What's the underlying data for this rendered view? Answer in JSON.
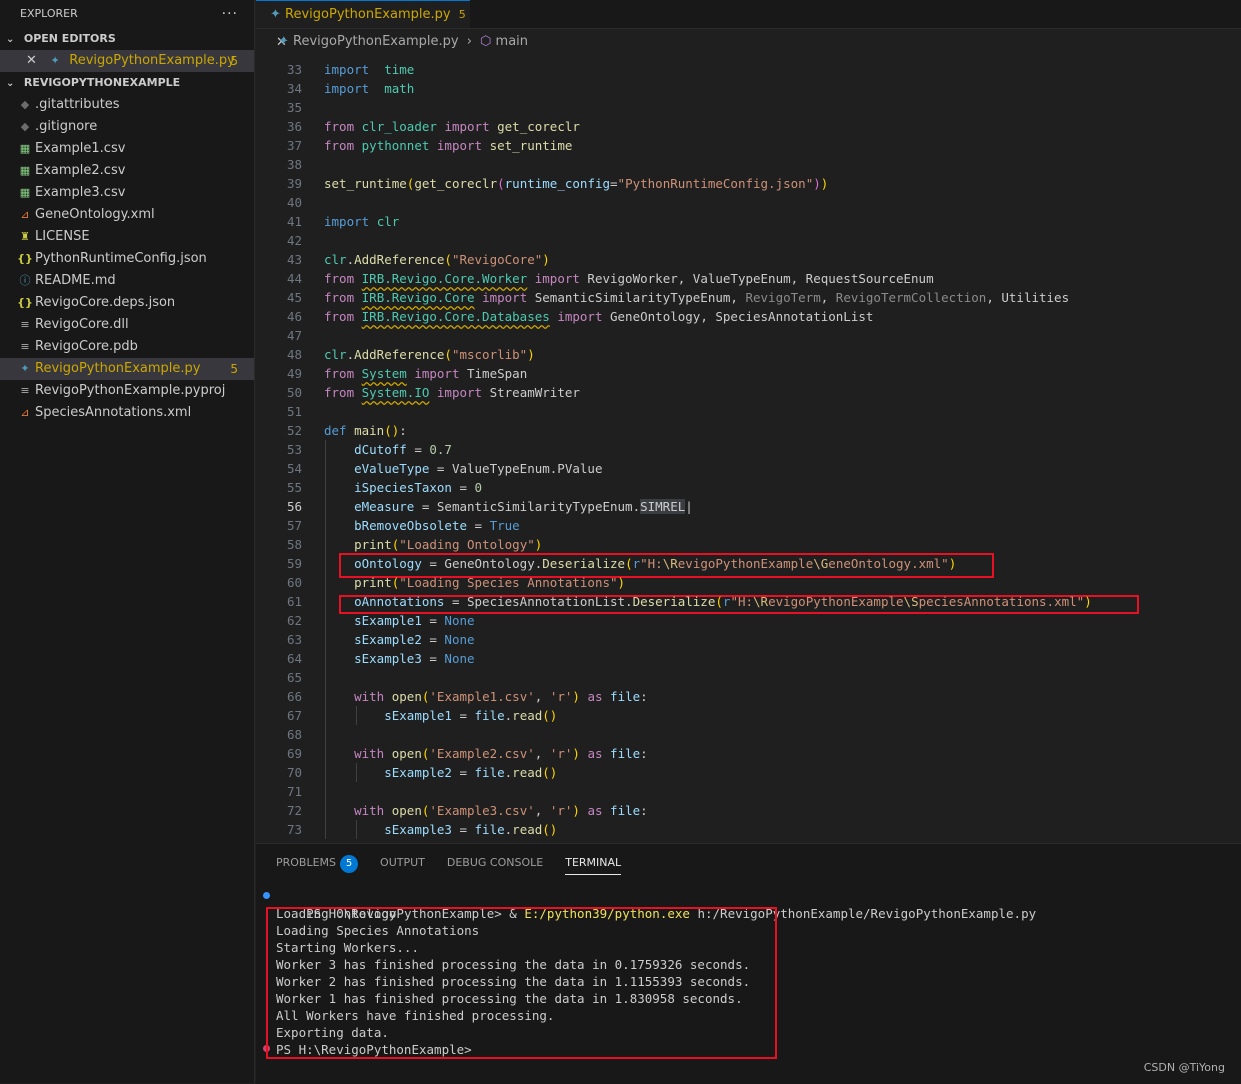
{
  "explorer": {
    "title": "EXPLORER",
    "more": "···",
    "open_editors_label": "OPEN EDITORS",
    "open_editor": {
      "name": "RevigoPythonExample.py",
      "badge": "5",
      "close": "✕"
    },
    "project_label": "REVIGOPYTHONEXAMPLE",
    "files": [
      {
        "name": ".gitattributes",
        "icon": "git-icon",
        "glyph": "◆"
      },
      {
        "name": ".gitignore",
        "icon": "git-icon",
        "glyph": "◆"
      },
      {
        "name": "Example1.csv",
        "icon": "csv-icon",
        "glyph": "▦"
      },
      {
        "name": "Example2.csv",
        "icon": "csv-icon",
        "glyph": "▦"
      },
      {
        "name": "Example3.csv",
        "icon": "csv-icon",
        "glyph": "▦"
      },
      {
        "name": "GeneOntology.xml",
        "icon": "rss-icon",
        "glyph": "⊿"
      },
      {
        "name": "LICENSE",
        "icon": "license-icon",
        "glyph": "♜"
      },
      {
        "name": "PythonRuntimeConfig.json",
        "icon": "json-icon",
        "glyph": "{}"
      },
      {
        "name": "README.md",
        "icon": "info-icon",
        "glyph": "ⓘ"
      },
      {
        "name": "RevigoCore.deps.json",
        "icon": "json-icon",
        "glyph": "{}"
      },
      {
        "name": "RevigoCore.dll",
        "icon": "file-lines-icon",
        "glyph": "≡"
      },
      {
        "name": "RevigoCore.pdb",
        "icon": "file-lines-icon",
        "glyph": "≡"
      },
      {
        "name": "RevigoPythonExample.py",
        "icon": "python-icon",
        "glyph": "✦",
        "active": true,
        "badge": "5"
      },
      {
        "name": "RevigoPythonExample.pyproj",
        "icon": "file-lines-icon",
        "glyph": "≡"
      },
      {
        "name": "SpeciesAnnotations.xml",
        "icon": "rss-icon",
        "glyph": "⊿"
      }
    ]
  },
  "tab": {
    "label": "RevigoPythonExample.py",
    "badge": "5",
    "close": "✕"
  },
  "breadcrumb": {
    "file": "RevigoPythonExample.py",
    "symbol": "main"
  },
  "line_numbers": [
    "33",
    "34",
    "35",
    "36",
    "37",
    "38",
    "39",
    "40",
    "41",
    "42",
    "43",
    "44",
    "45",
    "46",
    "47",
    "48",
    "49",
    "50",
    "51",
    "52",
    "53",
    "54",
    "55",
    "56",
    "57",
    "58",
    "59",
    "60",
    "61",
    "62",
    "63",
    "64",
    "65",
    "66",
    "67",
    "68",
    "69",
    "70",
    "71",
    "72",
    "73"
  ],
  "current_line": "56",
  "code": [
    [
      [
        "k",
        "import"
      ],
      [
        "",
        "  "
      ],
      [
        "c",
        "time"
      ]
    ],
    [
      [
        "k",
        "import"
      ],
      [
        "",
        "  "
      ],
      [
        "c",
        "math"
      ]
    ],
    [],
    [
      [
        "kc",
        "from"
      ],
      [
        "",
        " "
      ],
      [
        "c",
        "clr_loader"
      ],
      [
        "",
        " "
      ],
      [
        "kc",
        "import"
      ],
      [
        "",
        " "
      ],
      [
        "f",
        "get_coreclr"
      ]
    ],
    [
      [
        "kc",
        "from"
      ],
      [
        "",
        " "
      ],
      [
        "c",
        "pythonnet"
      ],
      [
        "",
        " "
      ],
      [
        "kc",
        "import"
      ],
      [
        "",
        " "
      ],
      [
        "f",
        "set_runtime"
      ]
    ],
    [],
    [
      [
        "f",
        "set_runtime"
      ],
      [
        "p1",
        "("
      ],
      [
        "f",
        "get_coreclr"
      ],
      [
        "p2",
        "("
      ],
      [
        "v",
        "runtime_config"
      ],
      [
        "",
        "="
      ],
      [
        "s",
        "\"PythonRuntimeConfig.json\""
      ],
      [
        "p2",
        ")"
      ],
      [
        "p1",
        ")"
      ]
    ],
    [],
    [
      [
        "k",
        "import"
      ],
      [
        "",
        " "
      ],
      [
        "c",
        "clr"
      ]
    ],
    [],
    [
      [
        "c",
        "clr"
      ],
      [
        "",
        "."
      ],
      [
        "f",
        "AddReference"
      ],
      [
        "p1",
        "("
      ],
      [
        "s",
        "\"RevigoCore\""
      ],
      [
        "p1",
        ")"
      ]
    ],
    [
      [
        "kc",
        "from"
      ],
      [
        "",
        " "
      ],
      [
        "c wv",
        "IRB.Revigo.Core.Worker"
      ],
      [
        "",
        " "
      ],
      [
        "kc",
        "import"
      ],
      [
        "",
        " RevigoWorker, ValueTypeEnum, RequestSourceEnum"
      ]
    ],
    [
      [
        "kc",
        "from"
      ],
      [
        "",
        " "
      ],
      [
        "c wv",
        "IRB.Revigo.Core"
      ],
      [
        "",
        " "
      ],
      [
        "kc",
        "import"
      ],
      [
        "",
        " SemanticSimilarityTypeEnum, "
      ],
      [
        "g",
        "RevigoTerm"
      ],
      [
        "",
        ", "
      ],
      [
        "g",
        "RevigoTermCollection"
      ],
      [
        "",
        ", Utilities"
      ]
    ],
    [
      [
        "kc",
        "from"
      ],
      [
        "",
        " "
      ],
      [
        "c wv",
        "IRB.Revigo.Core.Databases"
      ],
      [
        "",
        " "
      ],
      [
        "kc",
        "import"
      ],
      [
        "",
        " GeneOntology, SpeciesAnnotationList"
      ]
    ],
    [],
    [
      [
        "c",
        "clr"
      ],
      [
        "",
        "."
      ],
      [
        "f",
        "AddReference"
      ],
      [
        "p1",
        "("
      ],
      [
        "s",
        "\"mscorlib\""
      ],
      [
        "p1",
        ")"
      ]
    ],
    [
      [
        "kc",
        "from"
      ],
      [
        "",
        " "
      ],
      [
        "c wv",
        "System"
      ],
      [
        "",
        " "
      ],
      [
        "kc",
        "import"
      ],
      [
        "",
        " TimeSpan"
      ]
    ],
    [
      [
        "kc",
        "from"
      ],
      [
        "",
        " "
      ],
      [
        "c wv",
        "System.IO"
      ],
      [
        "",
        " "
      ],
      [
        "kc",
        "import"
      ],
      [
        "",
        " StreamWriter"
      ]
    ],
    [],
    [
      [
        "k",
        "def"
      ],
      [
        "",
        " "
      ],
      [
        "f",
        "main"
      ],
      [
        "p1",
        "()"
      ],
      [
        "",
        ":"
      ]
    ],
    [
      [
        "",
        "    "
      ],
      [
        "v",
        "dCutoff"
      ],
      [
        "",
        " = "
      ],
      [
        "n",
        "0.7"
      ]
    ],
    [
      [
        "",
        "    "
      ],
      [
        "v",
        "eValueType"
      ],
      [
        "",
        " = ValueTypeEnum.PValue"
      ]
    ],
    [
      [
        "",
        "    "
      ],
      [
        "v",
        "iSpeciesTaxon"
      ],
      [
        "",
        " = "
      ],
      [
        "n",
        "0"
      ]
    ],
    [
      [
        "",
        "    "
      ],
      [
        "v",
        "eMeasure"
      ],
      [
        "",
        " = SemanticSimilarityTypeEnum."
      ],
      [
        "sel",
        "SIMREL"
      ],
      [
        "",
        "|"
      ]
    ],
    [
      [
        "",
        "    "
      ],
      [
        "v",
        "bRemoveObsolete"
      ],
      [
        "",
        " = "
      ],
      [
        "k",
        "True"
      ]
    ],
    [
      [
        "",
        "    "
      ],
      [
        "f",
        "print"
      ],
      [
        "p1",
        "("
      ],
      [
        "s",
        "\"Loading Ontology\""
      ],
      [
        "p1",
        ")"
      ]
    ],
    [
      [
        "",
        "    "
      ],
      [
        "v",
        "oOntology"
      ],
      [
        "",
        " = GeneOntology."
      ],
      [
        "f",
        "Deserialize"
      ],
      [
        "p1",
        "("
      ],
      [
        "k",
        "r"
      ],
      [
        "s",
        "\"H:"
      ],
      [
        "esc",
        "\\R"
      ],
      [
        "s",
        "evigoPythonExample"
      ],
      [
        "esc",
        "\\G"
      ],
      [
        "s",
        "eneOntology.xml\""
      ],
      [
        "p1",
        ")"
      ]
    ],
    [
      [
        "",
        "    "
      ],
      [
        "f",
        "print"
      ],
      [
        "p1",
        "("
      ],
      [
        "s",
        "\"Loading Species Annotations\""
      ],
      [
        "p1",
        ")"
      ]
    ],
    [
      [
        "",
        "    "
      ],
      [
        "v",
        "oAnnotations"
      ],
      [
        "",
        " = SpeciesAnnotationList."
      ],
      [
        "f",
        "Deserialize"
      ],
      [
        "p1",
        "("
      ],
      [
        "k",
        "r"
      ],
      [
        "s",
        "\"H:"
      ],
      [
        "esc",
        "\\R"
      ],
      [
        "s",
        "evigoPythonExample"
      ],
      [
        "esc",
        "\\S"
      ],
      [
        "s",
        "peciesAnnotations.xml\""
      ],
      [
        "p1",
        ")"
      ]
    ],
    [
      [
        "",
        "    "
      ],
      [
        "v",
        "sExample1"
      ],
      [
        "",
        " = "
      ],
      [
        "k",
        "None"
      ]
    ],
    [
      [
        "",
        "    "
      ],
      [
        "v",
        "sExample2"
      ],
      [
        "",
        " = "
      ],
      [
        "k",
        "None"
      ]
    ],
    [
      [
        "",
        "    "
      ],
      [
        "v",
        "sExample3"
      ],
      [
        "",
        " = "
      ],
      [
        "k",
        "None"
      ]
    ],
    [],
    [
      [
        "",
        "    "
      ],
      [
        "kc",
        "with"
      ],
      [
        "",
        " "
      ],
      [
        "f",
        "open"
      ],
      [
        "p1",
        "("
      ],
      [
        "s",
        "'Example1.csv'"
      ],
      [
        "",
        ", "
      ],
      [
        "s",
        "'r'"
      ],
      [
        "p1",
        ")"
      ],
      [
        "",
        " "
      ],
      [
        "kc",
        "as"
      ],
      [
        "",
        " "
      ],
      [
        "v",
        "file"
      ],
      [
        "",
        ":"
      ]
    ],
    [
      [
        "",
        "        "
      ],
      [
        "v",
        "sExample1"
      ],
      [
        "",
        " = "
      ],
      [
        "v",
        "file"
      ],
      [
        "",
        "."
      ],
      [
        "f",
        "read"
      ],
      [
        "p1",
        "()"
      ]
    ],
    [],
    [
      [
        "",
        "    "
      ],
      [
        "kc",
        "with"
      ],
      [
        "",
        " "
      ],
      [
        "f",
        "open"
      ],
      [
        "p1",
        "("
      ],
      [
        "s",
        "'Example2.csv'"
      ],
      [
        "",
        ", "
      ],
      [
        "s",
        "'r'"
      ],
      [
        "p1",
        ")"
      ],
      [
        "",
        " "
      ],
      [
        "kc",
        "as"
      ],
      [
        "",
        " "
      ],
      [
        "v",
        "file"
      ],
      [
        "",
        ":"
      ]
    ],
    [
      [
        "",
        "        "
      ],
      [
        "v",
        "sExample2"
      ],
      [
        "",
        " = "
      ],
      [
        "v",
        "file"
      ],
      [
        "",
        "."
      ],
      [
        "f",
        "read"
      ],
      [
        "p1",
        "()"
      ]
    ],
    [],
    [
      [
        "",
        "    "
      ],
      [
        "kc",
        "with"
      ],
      [
        "",
        " "
      ],
      [
        "f",
        "open"
      ],
      [
        "p1",
        "("
      ],
      [
        "s",
        "'Example3.csv'"
      ],
      [
        "",
        ", "
      ],
      [
        "s",
        "'r'"
      ],
      [
        "p1",
        ")"
      ],
      [
        "",
        " "
      ],
      [
        "kc",
        "as"
      ],
      [
        "",
        " "
      ],
      [
        "v",
        "file"
      ],
      [
        "",
        ":"
      ]
    ],
    [
      [
        "",
        "        "
      ],
      [
        "v",
        "sExample3"
      ],
      [
        "",
        " = "
      ],
      [
        "v",
        "file"
      ],
      [
        "",
        "."
      ],
      [
        "f",
        "read"
      ],
      [
        "p1",
        "()"
      ]
    ]
  ],
  "panel": {
    "tabs": [
      {
        "label": "PROBLEMS",
        "badge": "5"
      },
      {
        "label": "OUTPUT"
      },
      {
        "label": "DEBUG CONSOLE"
      },
      {
        "label": "TERMINAL",
        "active": true
      }
    ],
    "command": {
      "prompt": "PS H:\\RevigoPythonExample> & ",
      "exe": "E:/python39/python.exe",
      "args": " h:/RevigoPythonExample/RevigoPythonExample.py"
    },
    "output": [
      "Loading Ontology",
      "Loading Species Annotations",
      "Starting Workers...",
      "Worker 3 has finished processing the data in 0.1759326 seconds.",
      "Worker 2 has finished processing the data in 1.1155393 seconds.",
      "Worker 1 has finished processing the data in 1.830958 seconds.",
      "All Workers have finished processing.",
      "Exporting data."
    ],
    "final_prompt": "PS H:\\RevigoPythonExample>"
  },
  "watermark": "CSDN @TiYong",
  "colors": {
    "accent": "#0078d4",
    "warning": "#cca700",
    "highlight_box": "#e81123"
  }
}
